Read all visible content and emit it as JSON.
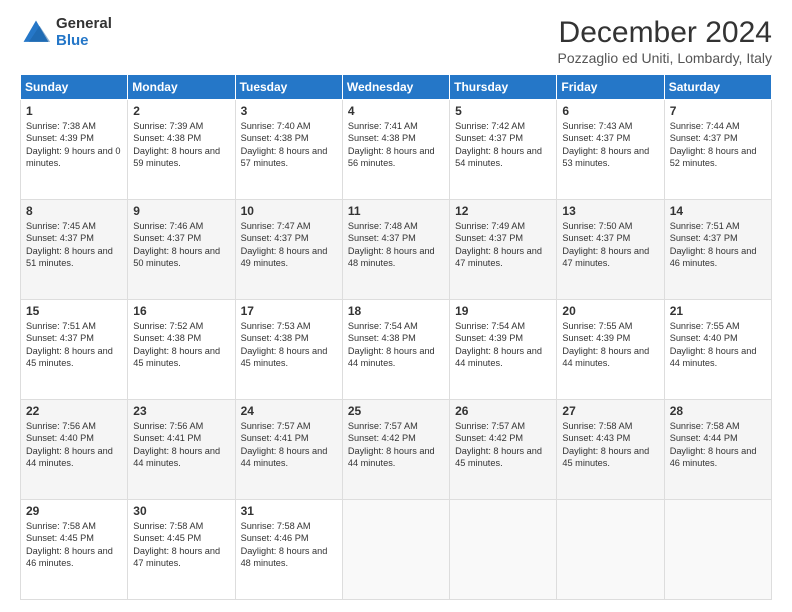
{
  "logo": {
    "general": "General",
    "blue": "Blue"
  },
  "title": "December 2024",
  "location": "Pozzaglio ed Uniti, Lombardy, Italy",
  "days_header": [
    "Sunday",
    "Monday",
    "Tuesday",
    "Wednesday",
    "Thursday",
    "Friday",
    "Saturday"
  ],
  "weeks": [
    [
      {
        "day": "1",
        "sunrise": "7:38 AM",
        "sunset": "4:39 PM",
        "daylight": "9 hours and 0 minutes."
      },
      {
        "day": "2",
        "sunrise": "7:39 AM",
        "sunset": "4:38 PM",
        "daylight": "8 hours and 59 minutes."
      },
      {
        "day": "3",
        "sunrise": "7:40 AM",
        "sunset": "4:38 PM",
        "daylight": "8 hours and 57 minutes."
      },
      {
        "day": "4",
        "sunrise": "7:41 AM",
        "sunset": "4:38 PM",
        "daylight": "8 hours and 56 minutes."
      },
      {
        "day": "5",
        "sunrise": "7:42 AM",
        "sunset": "4:37 PM",
        "daylight": "8 hours and 54 minutes."
      },
      {
        "day": "6",
        "sunrise": "7:43 AM",
        "sunset": "4:37 PM",
        "daylight": "8 hours and 53 minutes."
      },
      {
        "day": "7",
        "sunrise": "7:44 AM",
        "sunset": "4:37 PM",
        "daylight": "8 hours and 52 minutes."
      }
    ],
    [
      {
        "day": "8",
        "sunrise": "7:45 AM",
        "sunset": "4:37 PM",
        "daylight": "8 hours and 51 minutes."
      },
      {
        "day": "9",
        "sunrise": "7:46 AM",
        "sunset": "4:37 PM",
        "daylight": "8 hours and 50 minutes."
      },
      {
        "day": "10",
        "sunrise": "7:47 AM",
        "sunset": "4:37 PM",
        "daylight": "8 hours and 49 minutes."
      },
      {
        "day": "11",
        "sunrise": "7:48 AM",
        "sunset": "4:37 PM",
        "daylight": "8 hours and 48 minutes."
      },
      {
        "day": "12",
        "sunrise": "7:49 AM",
        "sunset": "4:37 PM",
        "daylight": "8 hours and 47 minutes."
      },
      {
        "day": "13",
        "sunrise": "7:50 AM",
        "sunset": "4:37 PM",
        "daylight": "8 hours and 47 minutes."
      },
      {
        "day": "14",
        "sunrise": "7:51 AM",
        "sunset": "4:37 PM",
        "daylight": "8 hours and 46 minutes."
      }
    ],
    [
      {
        "day": "15",
        "sunrise": "7:51 AM",
        "sunset": "4:37 PM",
        "daylight": "8 hours and 45 minutes."
      },
      {
        "day": "16",
        "sunrise": "7:52 AM",
        "sunset": "4:38 PM",
        "daylight": "8 hours and 45 minutes."
      },
      {
        "day": "17",
        "sunrise": "7:53 AM",
        "sunset": "4:38 PM",
        "daylight": "8 hours and 45 minutes."
      },
      {
        "day": "18",
        "sunrise": "7:54 AM",
        "sunset": "4:38 PM",
        "daylight": "8 hours and 44 minutes."
      },
      {
        "day": "19",
        "sunrise": "7:54 AM",
        "sunset": "4:39 PM",
        "daylight": "8 hours and 44 minutes."
      },
      {
        "day": "20",
        "sunrise": "7:55 AM",
        "sunset": "4:39 PM",
        "daylight": "8 hours and 44 minutes."
      },
      {
        "day": "21",
        "sunrise": "7:55 AM",
        "sunset": "4:40 PM",
        "daylight": "8 hours and 44 minutes."
      }
    ],
    [
      {
        "day": "22",
        "sunrise": "7:56 AM",
        "sunset": "4:40 PM",
        "daylight": "8 hours and 44 minutes."
      },
      {
        "day": "23",
        "sunrise": "7:56 AM",
        "sunset": "4:41 PM",
        "daylight": "8 hours and 44 minutes."
      },
      {
        "day": "24",
        "sunrise": "7:57 AM",
        "sunset": "4:41 PM",
        "daylight": "8 hours and 44 minutes."
      },
      {
        "day": "25",
        "sunrise": "7:57 AM",
        "sunset": "4:42 PM",
        "daylight": "8 hours and 44 minutes."
      },
      {
        "day": "26",
        "sunrise": "7:57 AM",
        "sunset": "4:42 PM",
        "daylight": "8 hours and 45 minutes."
      },
      {
        "day": "27",
        "sunrise": "7:58 AM",
        "sunset": "4:43 PM",
        "daylight": "8 hours and 45 minutes."
      },
      {
        "day": "28",
        "sunrise": "7:58 AM",
        "sunset": "4:44 PM",
        "daylight": "8 hours and 46 minutes."
      }
    ],
    [
      {
        "day": "29",
        "sunrise": "7:58 AM",
        "sunset": "4:45 PM",
        "daylight": "8 hours and 46 minutes."
      },
      {
        "day": "30",
        "sunrise": "7:58 AM",
        "sunset": "4:45 PM",
        "daylight": "8 hours and 47 minutes."
      },
      {
        "day": "31",
        "sunrise": "7:58 AM",
        "sunset": "4:46 PM",
        "daylight": "8 hours and 48 minutes."
      },
      null,
      null,
      null,
      null
    ]
  ],
  "labels": {
    "sunrise": "Sunrise:",
    "sunset": "Sunset:",
    "daylight": "Daylight:"
  }
}
